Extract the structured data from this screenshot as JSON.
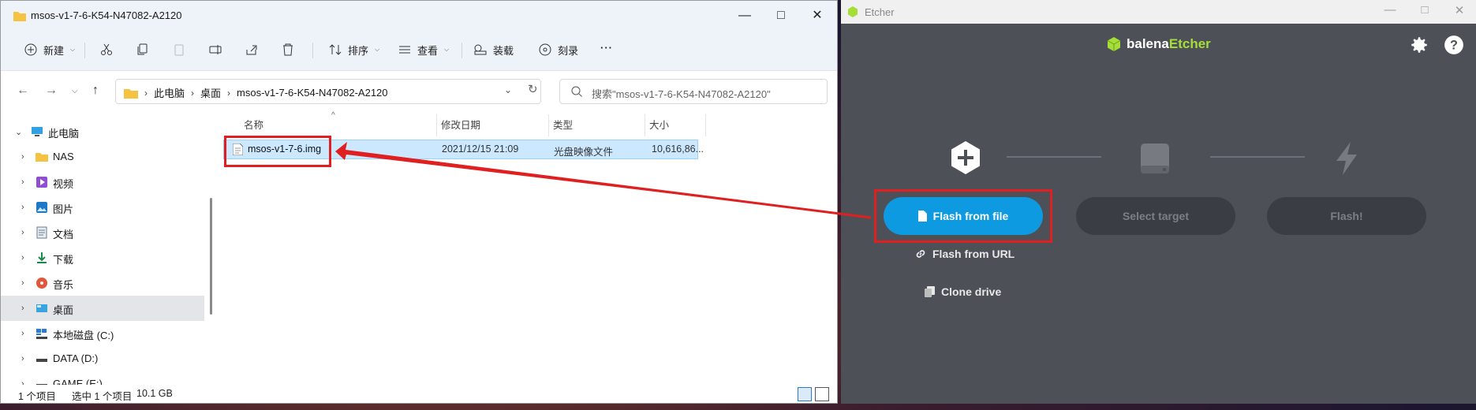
{
  "explorer": {
    "window_title": "msos-v1-7-6-K54-N47082-A2120",
    "toolbar": {
      "new_label": "新建",
      "sort_label": "排序",
      "view_label": "查看",
      "mount_label": "装载",
      "burn_label": "刻录",
      "more_label": "···"
    },
    "breadcrumb": [
      "此电脑",
      "桌面",
      "msos-v1-7-6-K54-N47082-A2120"
    ],
    "search_placeholder": "搜索\"msos-v1-7-6-K54-N47082-A2120\"",
    "sidebar": {
      "root": "此电脑",
      "items": [
        "NAS",
        "视频",
        "图片",
        "文档",
        "下载",
        "音乐",
        "桌面",
        "本地磁盘 (C:)",
        "DATA (D:)",
        "GAME (E:)"
      ],
      "selected": "桌面"
    },
    "columns": {
      "name": "名称",
      "modified": "修改日期",
      "type": "类型",
      "size": "大小"
    },
    "files": [
      {
        "name": "msos-v1-7-6.img",
        "modified": "2021/12/15 21:09",
        "type": "光盘映像文件",
        "size": "10,616,86..."
      }
    ],
    "status": {
      "count": "1 个项目",
      "selected": "选中 1 个项目",
      "size": "10.1 GB"
    }
  },
  "etcher": {
    "window_title": "Etcher",
    "brand_left": "balena",
    "brand_right": "Etcher",
    "steps": {
      "flash_from_file": "Flash from file",
      "select_target": "Select target",
      "flash": "Flash!",
      "flash_from_url": "Flash from URL",
      "clone_drive": "Clone drive"
    },
    "colors": {
      "primary": "#0d9ae0",
      "brand_green": "#a5de37",
      "background": "#4d5057",
      "annotation_red": "#e02020"
    }
  }
}
